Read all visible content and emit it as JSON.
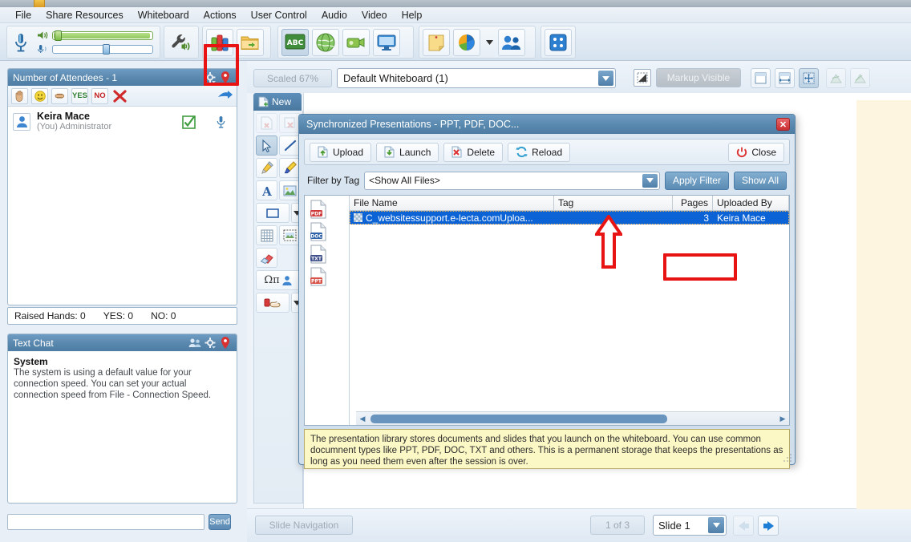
{
  "menu": {
    "items": [
      {
        "label": "File"
      },
      {
        "label": "Share Resources"
      },
      {
        "label": "Whiteboard"
      },
      {
        "label": "Actions"
      },
      {
        "label": "User Control"
      },
      {
        "label": "Audio"
      },
      {
        "label": "Video"
      },
      {
        "label": "Help"
      }
    ]
  },
  "toolbar": {
    "mic_icon": "microphone-icon",
    "speaker_icon": "speaker-icon",
    "mic_small_icon": "microphone-small-icon",
    "settings_icon": "audio-settings-wrench-icon",
    "library_icon": "presentation-library-books-icon",
    "folder_icon": "file-share-folder-icon",
    "whiteboard_icon": "abc-whiteboard-icon",
    "web_icon": "web-tour-globe-icon",
    "recording_icon": "recording-camera-icon",
    "screen_icon": "screen-sharing-monitor-icon",
    "notes_icon": "notes-sticky-icon",
    "poll_icon": "poll-chart-icon",
    "poll_dropdown_icon": "chevron-down-icon",
    "users_icon": "users-group-icon",
    "games_icon": "dice-icon"
  },
  "attendees": {
    "title": "Number of Attendees - 1",
    "gear_icon": "gear-icon",
    "pin_icon": "pin-icon",
    "actions": [
      {
        "name": "raise-hand",
        "label": "",
        "icon": "hand-icon"
      },
      {
        "name": "smile",
        "label": "",
        "icon": "smiley-icon"
      },
      {
        "name": "clap",
        "label": "",
        "icon": "clap-hand-icon"
      },
      {
        "name": "yes",
        "label": "YES",
        "icon": "yes-icon"
      },
      {
        "name": "no",
        "label": "NO",
        "icon": "no-icon"
      },
      {
        "name": "clear",
        "label": "",
        "icon": "clear-red-x-icon"
      }
    ],
    "forward_icon": "forward-arrow-icon",
    "list": [
      {
        "name": "Keira Mace",
        "role": "(You) Administrator",
        "avatar_icon": "user-avatar-icon",
        "check_icon": "green-check-icon",
        "mic_icon": "microphone-icon"
      }
    ],
    "status": {
      "raised_hands": "Raised Hands:  0",
      "yes": "YES: 0",
      "no": "NO: 0"
    }
  },
  "chat": {
    "title": "Text Chat",
    "users_icon": "users-icon",
    "gear_icon": "gear-icon",
    "pin_icon": "pin-icon",
    "messages": [
      {
        "sender": "System",
        "text": "The system is using a default value for your connection speed. You can set your actual connection speed from File - Connection Speed."
      }
    ],
    "input_value": "",
    "input_placeholder": "",
    "send_label": "Send"
  },
  "whiteboard": {
    "scaled_label": "Scaled 67%",
    "selected_board": "Default Whiteboard (1)",
    "dropdown_icon": "chevron-down-icon",
    "select_region_icon": "select-region-icon",
    "markup_label": "Markup Visible",
    "view_buttons": [
      {
        "name": "fit-page-icon",
        "active": false
      },
      {
        "name": "fit-width-icon",
        "active": false
      },
      {
        "name": "fit-screen-icon",
        "active": true
      },
      {
        "name": "zoom-out-icon",
        "active": false,
        "dim": true
      },
      {
        "name": "zoom-in-icon",
        "active": false,
        "dim": true
      }
    ],
    "new_tab_label": "New",
    "new_tab_icon": "new-page-icon",
    "tools": [
      {
        "name": "clear-page-icon",
        "selected": false,
        "dim": true
      },
      {
        "name": "delete-page-icon",
        "selected": false,
        "dim": true
      },
      {
        "name": "pointer-select-icon",
        "selected": true,
        "dim": false
      },
      {
        "name": "line-tool-icon",
        "selected": false,
        "dim": false
      },
      {
        "name": "pencil-tool-icon",
        "selected": false,
        "dim": false
      },
      {
        "name": "highlighter-tool-icon",
        "selected": false,
        "dim": false
      },
      {
        "name": "text-tool-icon",
        "selected": false,
        "dim": false
      },
      {
        "name": "image-tool-icon",
        "selected": false,
        "dim": false
      },
      {
        "name": "shape-rectangle-tool-icon",
        "selected": false,
        "dim": false
      },
      {
        "name": "shape-dropdown-icon",
        "selected": false,
        "dim": false
      },
      {
        "name": "grid-tool-icon",
        "selected": false,
        "dim": false
      },
      {
        "name": "screenshot-tool-icon",
        "selected": false,
        "dim": false
      },
      {
        "name": "eraser-tool-icon",
        "selected": false,
        "dim": false
      },
      {
        "name": "symbols-tool-icon",
        "selected": false,
        "dim": false
      },
      {
        "name": "pointer-hand-tool-icon",
        "selected": false,
        "dim": false
      },
      {
        "name": "pointer-hand-dropdown-icon",
        "selected": false,
        "dim": false
      }
    ],
    "bottom": {
      "slide_nav_label": "Slide Navigation",
      "page_counter": "1 of 3",
      "slide_select": "Slide 1",
      "slide_dropdown_icon": "chevron-down-icon",
      "prev_icon": "arrow-left-icon",
      "next_icon": "arrow-right-icon"
    }
  },
  "dialog": {
    "title": "Synchronized Presentations - PPT, PDF, DOC...",
    "close_icon": "close-x-icon",
    "buttons": [
      {
        "label": "Upload",
        "icon": "upload-icon",
        "highlight": false
      },
      {
        "label": "Launch",
        "icon": "launch-icon",
        "highlight": true
      },
      {
        "label": "Delete",
        "icon": "delete-icon",
        "highlight": false
      },
      {
        "label": "Reload",
        "icon": "reload-icon",
        "highlight": false
      }
    ],
    "close_button": {
      "label": "Close",
      "icon": "power-icon"
    },
    "filter": {
      "label": "Filter by Tag",
      "value": "<Show All Files>",
      "dropdown_icon": "chevron-down-icon",
      "apply_label": "Apply Filter",
      "show_all_label": "Show All"
    },
    "file_type_icons": [
      "pdf-file-icon",
      "doc-file-icon",
      "txt-file-icon",
      "ppt-file-icon"
    ],
    "table": {
      "columns": [
        "File Name",
        "Tag",
        "Pages",
        "Uploaded By"
      ],
      "rows": [
        {
          "file_name": "C_websitessupport.e-lecta.comUploa...",
          "tag": "",
          "pages": "3",
          "uploaded_by": "Keira Mace",
          "selected": true,
          "icon": "file-thumbnail-icon"
        }
      ]
    },
    "scrollbar": {
      "left_icon": "scroll-left-icon",
      "right_icon": "scroll-right-icon"
    },
    "info_text": "The presentation library stores documents and slides that you launch on the whiteboard. You can use common documnent types like PPT, PDF, DOC, TXT and others. This is a permanent storage that keeps the presentations as long as you need them even after the session is over.",
    "resizer_icon": "resize-grip-icon"
  },
  "annotations": {
    "toolbar_highlight": "red-highlight-box-library-button",
    "launch_highlight": "red-highlight-box-launch-button",
    "pointer_arrow": "red-up-arrow-annotation"
  },
  "colors": {
    "accent_blue": "#4d7ba3",
    "highlight_red": "#e81313",
    "selection_blue": "#0b63d6",
    "info_yellow": "#fcf8c6",
    "cream_panel": "#fdf5e0"
  }
}
